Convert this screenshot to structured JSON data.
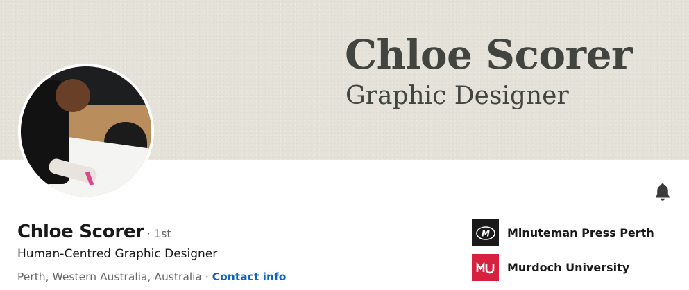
{
  "banner": {
    "name": "Chloe Scorer",
    "role": "Graphic Designer"
  },
  "profile": {
    "name": "Chloe Scorer",
    "degree": "· 1st",
    "headline": "Human-Centred Graphic Designer",
    "location": "Perth, Western Australia, Australia",
    "separator": " · ",
    "contact_label": "Contact info"
  },
  "organizations": [
    {
      "name": "Minuteman Press Perth",
      "logo_icon": "minuteman-press-logo",
      "logo_color": "#1a1a1a"
    },
    {
      "name": "Murdoch University",
      "logo_icon": "murdoch-university-logo",
      "logo_color": "#d62240"
    }
  ],
  "icons": {
    "bell": "bell-icon"
  },
  "colors": {
    "banner_bg": "#e5e2d9",
    "banner_text": "#41443f",
    "link": "#0a66c2",
    "secondary_text": "#666666"
  }
}
